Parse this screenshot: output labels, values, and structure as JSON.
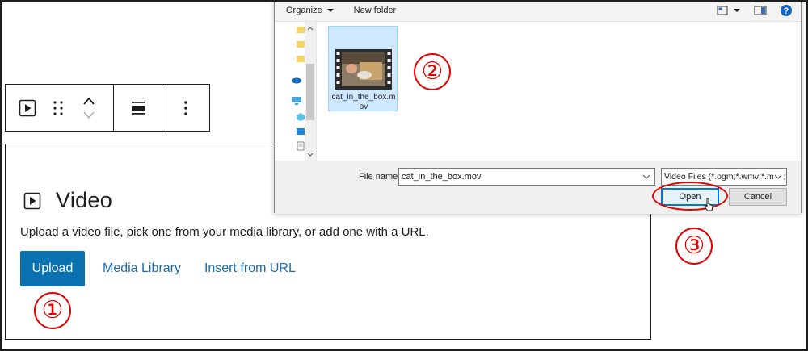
{
  "colors": {
    "primary": "#0a72b0",
    "link": "#1a6db0",
    "annotation": "#e60000",
    "selection": "#cde8ff",
    "focus": "#0078d7"
  },
  "toolbar": {
    "block_icon": "video-play-icon",
    "drag_icon": "drag-handle-icon",
    "move_up_icon": "chevron-up-icon",
    "move_down_icon": "chevron-down-icon",
    "align_icon": "align-wide-icon",
    "options_icon": "more-vertical-icon"
  },
  "video_block": {
    "title": "Video",
    "instructions": "Upload a video file, pick one from your media library, or add one with a URL.",
    "upload_label": "Upload",
    "media_library_label": "Media Library",
    "insert_url_label": "Insert from URL"
  },
  "annotations": {
    "step1": "①",
    "step2": "②",
    "step3": "③"
  },
  "dialog": {
    "organize_label": "Organize",
    "new_folder_label": "New folder",
    "file": {
      "name": "cat_in_the_box.mov"
    },
    "file_name_label": "File name:",
    "file_name_value": "cat_in_the_box.mov",
    "file_type_value": "Video Files (*.ogm;*.wmv;*.mpg;*.webm;*.ogv;*.mov;*.asx;*.mpeg;*.mp4;*.m4v;*.avi)",
    "open_label": "Open",
    "cancel_label": "Cancel"
  }
}
